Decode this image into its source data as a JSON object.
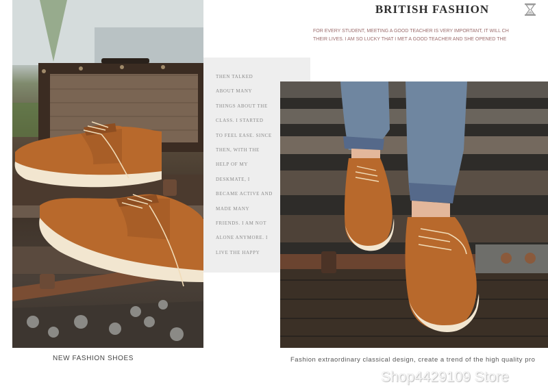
{
  "header": {
    "title": "BRITISH FASHION",
    "tagline": [
      "FOR EVERY STUDENT, MEETING A GOOD TEACHER IS VERY IMPORTANT, IT WILL CH",
      "THEIR LIVES. I AM SO LUCKY THAT I MET A GOOD TEACHER AND SHE OPENED THE"
    ],
    "icon": "hourglass-icon"
  },
  "story_lines": [
    "THEN TALKED",
    "ABOUT MANY",
    "THINGS ABOUT THE",
    "CLASS. I STARTED",
    "TO FEEL EASE. SINCE",
    "THEN, WITH THE",
    "HELP OF MY",
    "DESKMATE, I",
    "BECAME ACTIVE AND",
    "MADE MANY",
    "FRIENDS. I AM NOT",
    "ALONE ANYMORE. I",
    "LIVE THE HAPPY"
  ],
  "captions": {
    "left": "NEW FASHION SHOES",
    "right": "Fashion extraordinary classical design, create a trend of the high quality pro"
  },
  "watermark": "Shop4429109 Store",
  "colors": {
    "shoe_suede": "#b8692c",
    "sole": "#f2e6d0",
    "denim": "#6f86a0",
    "panel": "#eeeeee"
  }
}
